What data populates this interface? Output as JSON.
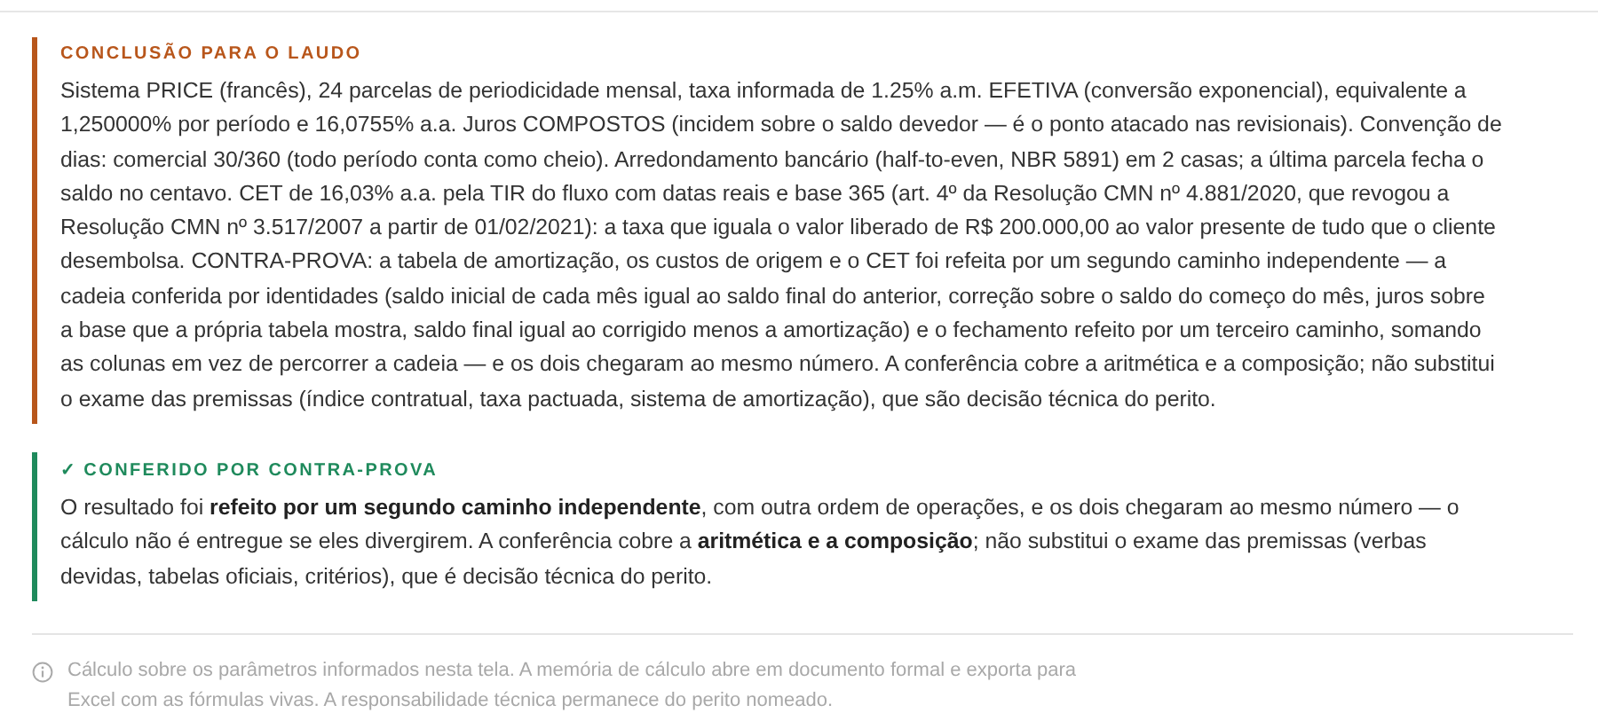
{
  "sections": [
    {
      "kind": "conclusion",
      "heading": "CONCLUSÃO PARA O LAUDO",
      "text": "Sistema PRICE (francês), 24 parcelas de periodicidade mensal, taxa informada de 1.25% a.m. EFETIVA (conversão exponencial), equivalente a 1,250000% por período e 16,0755% a.a. Juros COMPOSTOS (incidem sobre o saldo devedor — é o ponto atacado nas revisionais). Convenção de dias: comercial 30/360 (todo período conta como cheio). Arredondamento bancário (half-to-even, NBR 5891) em 2 casas; a última parcela fecha o saldo no centavo. CET de 16,03% a.a. pela TIR do fluxo com datas reais e base 365 (art. 4º da Resolução CMN nº 4.881/2020, que revogou a Resolução CMN nº 3.517/2007 a partir de 01/02/2021): a taxa que iguala o valor liberado de R$ 200.000,00 ao valor presente de tudo que o cliente desembolsa. CONTRA-PROVA: a tabela de amortização, os custos de origem e o CET foi refeita por um segundo caminho independente — a cadeia conferida por identidades (saldo inicial de cada mês igual ao saldo final do anterior, correção sobre o saldo do começo do mês, juros sobre a base que a própria tabela mostra, saldo final igual ao corrigido menos a amortização) e o fechamento refeito por um terceiro caminho, somando as colunas em vez de percorrer a cadeia — e os dois chegaram ao mesmo número. A conferência cobre a aritmética e a composição; não substitui o exame das premissas (índice contratual, taxa pactuada, sistema de amortização), que são decisão técnica do perito."
    },
    {
      "kind": "verified",
      "heading": "✓ CONFERIDO POR CONTRA-PROVA",
      "text": "O resultado foi **refeito por um segundo caminho independente**, com outra ordem de operações, e os dois chegaram ao mesmo número — o cálculo não é entregue se eles divergirem. A conferência cobre a **aritmética e a composição**; não substitui o exame das premissas (verbas devidas, tabelas oficiais, critérios), que é decisão técnica do perito."
    }
  ],
  "footnote": "Cálculo sobre os parâmetros informados nesta tela. A memória de cálculo abre em documento formal e exporta para Excel com as fórmulas vivas. A responsabilidade técnica permanece do perito nomeado."
}
